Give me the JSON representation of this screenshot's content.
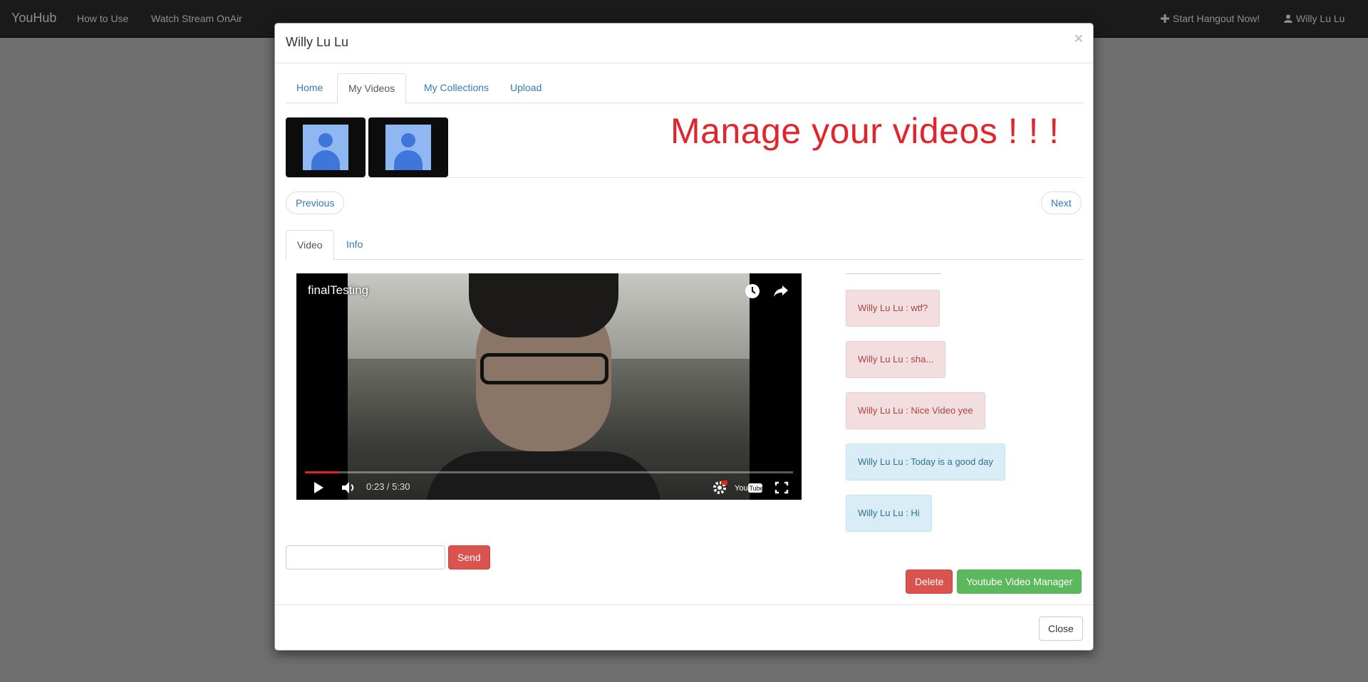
{
  "navbar": {
    "brand": "YouHub",
    "links": [
      "How to Use",
      "Watch Stream OnAir"
    ],
    "hangout_label": "Start Hangout Now!",
    "user_label": "Willy Lu Lu"
  },
  "modal": {
    "title": "Willy Lu Lu",
    "close_glyph": "×",
    "tabs": [
      "Home",
      "My Videos",
      "My Collections",
      "Upload"
    ],
    "active_tab": "My Videos",
    "headline": "Manage your videos ! ! !",
    "pager": {
      "previous": "Previous",
      "next": "Next"
    },
    "subtabs": [
      "Video",
      "Info"
    ],
    "active_subtab": "Video",
    "player": {
      "title": "finalTesting",
      "time": "0:23 / 5:30",
      "progress_fraction": 0.07
    },
    "chat": {
      "messages": [
        {
          "text": "Willy Lu Lu : wtf?",
          "style": "danger"
        },
        {
          "text": "Willy Lu Lu : sha...",
          "style": "danger"
        },
        {
          "text": "Willy Lu Lu : Nice Video yee",
          "style": "danger"
        },
        {
          "text": "Willy Lu Lu : Today is a good day",
          "style": "info"
        },
        {
          "text": "Willy Lu Lu : Hi",
          "style": "info"
        }
      ],
      "input_value": "",
      "send_label": "Send"
    },
    "actions": {
      "delete_label": "Delete",
      "manager_label": "Youtube Video Manager"
    },
    "footer": {
      "close_label": "Close"
    }
  },
  "colors": {
    "navbar_bg": "#1a1a1a",
    "headline": "#e0262c",
    "danger": "#d9534f",
    "success": "#5cb85c",
    "link": "#337ab7"
  }
}
